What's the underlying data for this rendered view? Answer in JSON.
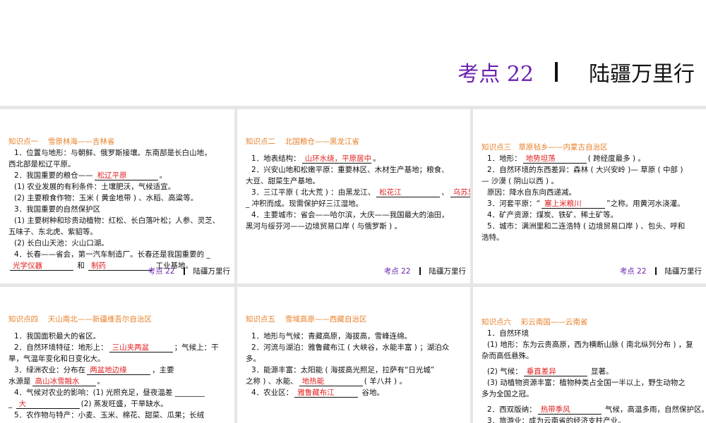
{
  "title": {
    "kd": "考点 22",
    "name": "陆疆万里行"
  },
  "colors": {
    "heading": "#e8802a",
    "answer": "#e02020",
    "accent": "#6a22b0"
  },
  "panels": [
    {
      "heading": "知识点一　 雪原林海——吉林省",
      "footer": true,
      "lines": [
        {
          "ind": 1,
          "s": [
            {
              "t": "1．位置与地形：与朝鲜、俄罗斯接壤。东南部是长白山地，"
            }
          ]
        },
        {
          "s": [
            {
              "t": "西北部是松辽平原。"
            }
          ]
        },
        {
          "ind": 1,
          "s": [
            {
              "t": "2．我国重要的粮仓——"
            },
            {
              "b": "松辽平原"
            },
            {
              "t": "。"
            }
          ]
        },
        {
          "ind": 1,
          "s": [
            {
              "t": "(1) 农业发展的有利条件：土壤肥沃，气候适宜。"
            }
          ]
        },
        {
          "ind": 1,
          "s": [
            {
              "t": "(2) 主要粮食作物：玉米 ( 黄金地带 ) 、水稻、高粱等。"
            }
          ]
        },
        {
          "ind": 1,
          "s": [
            {
              "t": "3．我国重要的自然保护区"
            }
          ]
        },
        {
          "ind": 1,
          "s": [
            {
              "t": "(1) 主要树种和珍贵动植物：红松、长白落叶松；人参、灵芝、"
            }
          ]
        },
        {
          "s": [
            {
              "t": "五味子、东北虎、紫貂等。"
            }
          ]
        },
        {
          "ind": 1,
          "s": [
            {
              "t": "(2) 长白山天池：火山口湖。"
            }
          ]
        },
        {
          "ind": 1,
          "s": [
            {
              "t": "4．长春——省会，第一汽车制造厂。长春还是我国重要的 _"
            }
          ]
        },
        {
          "s": [
            {
              "b": "光学仪器"
            },
            {
              "t": " 和 "
            },
            {
              "b": "制药"
            },
            {
              "t": " 工业基地。"
            }
          ]
        }
      ]
    },
    {
      "heading": "知识点二　 北国粮仓——黑龙江省",
      "footer": true,
      "lines": [
        {
          "ind": 1,
          "s": [
            {
              "t": "1．地表结构："
            },
            {
              "b": "山环水绕，平原居中"
            },
            {
              "t": "。"
            }
          ]
        },
        {
          "ind": 1,
          "s": [
            {
              "t": "2．兴安山地和松嫩平原：重要林区、木材生产基地；粮食、"
            }
          ]
        },
        {
          "s": [
            {
              "t": "大豆、甜菜生产基地。"
            }
          ]
        },
        {
          "ind": 1,
          "s": [
            {
              "t": "3．三江平原 ( 北大荒 ) ：由黑龙江、"
            },
            {
              "b": "松花江"
            },
            {
              "t": "、"
            },
            {
              "b": "乌苏里江"
            }
          ]
        },
        {
          "s": [
            {
              "t": "_ 冲积而成。现需保护好三江湿地。"
            }
          ]
        },
        {
          "ind": 1,
          "s": [
            {
              "t": "4．主要城市：省会——哈尔滨，大庆——我国最大的油田，"
            }
          ]
        },
        {
          "s": [
            {
              "t": "黑河与绥芬河——边境贸易口岸 ( 与俄罗斯 ) 。"
            }
          ]
        }
      ]
    },
    {
      "heading": "知识点三　草原毡乡——内蒙古自治区",
      "footer": true,
      "lines": [
        {
          "ind": 1,
          "s": [
            {
              "t": "1．地形："
            },
            {
              "b": "地势坦荡"
            },
            {
              "t": "( 跨经度最多 ) 。"
            }
          ]
        },
        {
          "ind": 1,
          "s": [
            {
              "t": "2．自然环境的东西差异：森林 ( 大兴安岭 )— 草原 ( 中部 )"
            }
          ]
        },
        {
          "s": [
            {
              "t": "— 沙漠 ( 阴山以西 ) 。"
            }
          ]
        },
        {
          "ind": 1,
          "s": [
            {
              "t": "原因：降水自东向西递减。"
            }
          ]
        },
        {
          "ind": 1,
          "s": [
            {
              "t": "3．河套平原：“"
            },
            {
              "b": "塞上米粮川"
            },
            {
              "t": "”之称。用黄河水浇灌。"
            }
          ]
        },
        {
          "ind": 1,
          "s": [
            {
              "t": "4．矿产资源：煤炭、铁矿、稀土矿等。"
            }
          ]
        },
        {
          "ind": 1,
          "s": [
            {
              "t": "5．城市：满洲里和二连浩特 ( 边境贸易口岸 ) 、包头、呼和"
            }
          ]
        },
        {
          "s": [
            {
              "t": "浩特。"
            }
          ]
        }
      ]
    },
    {
      "heading": "知识点四　 天山南北——新疆维吾尔自治区",
      "footer": false,
      "lines": [
        {
          "ind": 1,
          "s": [
            {
              "t": "1．我国面积最大的省区。"
            }
          ]
        },
        {
          "ind": 1,
          "s": [
            {
              "t": "2．自然环境特征：地形上："
            },
            {
              "b": "三山夹两盆"
            },
            {
              "t": "；气候上：干"
            }
          ]
        },
        {
          "s": [
            {
              "t": "旱，气温年变化和日变化大。"
            }
          ]
        },
        {
          "ind": 1,
          "s": [
            {
              "t": "3．绿洲农业：分布在"
            },
            {
              "b": "两盆地边缘"
            },
            {
              "t": "，主要"
            }
          ]
        },
        {
          "s": [
            {
              "t": "水源是"
            },
            {
              "b": "高山冰雪融水"
            },
            {
              "t": "。"
            }
          ]
        },
        {
          "ind": 1,
          "s": [
            {
              "t": "4．气候对农业的影响：(1) 光照充足，昼夜温差 ________"
            }
          ]
        },
        {
          "s": [
            {
              "t": "_ "
            },
            {
              "b": "大"
            },
            {
              "t": "(2) 蒸发旺盛，干旱缺水。"
            }
          ]
        },
        {
          "ind": 1,
          "s": [
            {
              "t": "5．农作物与特产：小麦、玉米、棉花、甜菜、瓜果；长绒"
            }
          ]
        }
      ]
    },
    {
      "heading": "知识点五　 雪域高原——西藏自治区",
      "footer": false,
      "lines": [
        {
          "ind": 1,
          "s": [
            {
              "t": "1．地形与气候：青藏高原，海拔高，雪峰连绵。"
            }
          ]
        },
        {
          "ind": 1,
          "s": [
            {
              "t": "2．河流与湖泊：雅鲁藏布江 ( 大峡谷，水能丰富 ) ；湖泊众"
            }
          ]
        },
        {
          "s": [
            {
              "t": "多。"
            }
          ]
        },
        {
          "ind": 1,
          "s": [
            {
              "t": "3．能源丰富：太阳能 ( 海拔高光照足，拉萨有“日光城”"
            }
          ]
        },
        {
          "s": [
            {
              "t": "之称 ) 、水能、"
            },
            {
              "b": "地热能"
            },
            {
              "t": "( 羊八井 ) 。"
            }
          ]
        },
        {
          "ind": 1,
          "s": [
            {
              "t": "4．农业区："
            },
            {
              "b": "雅鲁藏布江"
            },
            {
              "t": " 谷地。"
            }
          ]
        }
      ]
    },
    {
      "heading": "知识点六　 彩云南国——云南省",
      "footer": false,
      "lines": [
        {
          "ind": 1,
          "s": [
            {
              "t": "1．自然环境"
            }
          ]
        },
        {
          "ind": 1,
          "s": [
            {
              "t": "(1) 地形：东为云贵高原，西为横断山脉 ( 南北纵列分布 ) ，复"
            }
          ]
        },
        {
          "s": [
            {
              "t": "杂而高低悬殊。"
            }
          ]
        },
        {
          "ind": 1,
          "gap": 1,
          "s": [
            {
              "t": "(2) 气候："
            },
            {
              "b": "垂直差异"
            },
            {
              "t": " 显著。"
            }
          ]
        },
        {
          "ind": 1,
          "s": [
            {
              "t": "(3) 动植物资源丰富：植物种类占全国一半以上，野生动物之"
            }
          ]
        },
        {
          "s": [
            {
              "t": "多为全国之冠。"
            }
          ]
        },
        {
          "ind": 1,
          "gap": 1,
          "s": [
            {
              "t": "2．西双版纳："
            },
            {
              "b": "热带季风"
            },
            {
              "t": " 气候，高温多雨，自然保护区。"
            }
          ]
        },
        {
          "ind": 1,
          "s": [
            {
              "t": "3．旅游业：成为云南省的经济支柱产业。"
            }
          ]
        }
      ]
    }
  ]
}
